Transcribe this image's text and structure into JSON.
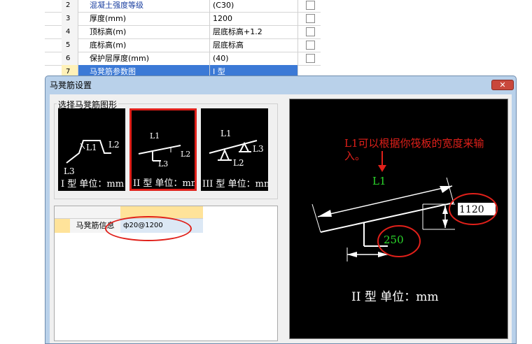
{
  "properties": {
    "rows": [
      {
        "num": "2",
        "name": "混凝土强度等级",
        "value": "(C30)"
      },
      {
        "num": "3",
        "name": "厚度(mm)",
        "value": "1200"
      },
      {
        "num": "4",
        "name": "顶标高(m)",
        "value": "层底标高+1.2"
      },
      {
        "num": "5",
        "name": "底标高(m)",
        "value": "层底标高"
      },
      {
        "num": "6",
        "name": "保护层厚度(mm)",
        "value": "(40)"
      },
      {
        "num": "7",
        "name": "马凳筋参数图",
        "value": "I 型"
      }
    ]
  },
  "dialog": {
    "title": "马凳筋设置",
    "close_icon": "close-icon",
    "group_label": "选择马凳筋图形",
    "shapes": [
      {
        "name": "I 型  单位：mm",
        "labels": [
          "L1",
          "L2",
          "L3"
        ],
        "selected": false
      },
      {
        "name": "II 型  单位：mm",
        "labels": [
          "L1",
          "L2",
          "L3"
        ],
        "selected": true
      },
      {
        "name": "III 型  单位：mm",
        "labels": [
          "L1",
          "L2",
          "L3"
        ],
        "selected": false
      }
    ],
    "info_grid": {
      "row_label": "马凳筋信息",
      "row_value": "ф20@1200"
    },
    "preview": {
      "l1": "L1",
      "dim_height": "1120",
      "dim_width": "250",
      "caption": "II 型  单位：mm"
    },
    "annotation": {
      "text_line1": "L1可以根据你筏板的宽度来输",
      "text_line2": "入。"
    },
    "colors": {
      "dialog_frame": "#b9d1ea",
      "highlight": "#e0201a",
      "green": "#2bd62b",
      "selected_row": "#3b79d6"
    }
  }
}
